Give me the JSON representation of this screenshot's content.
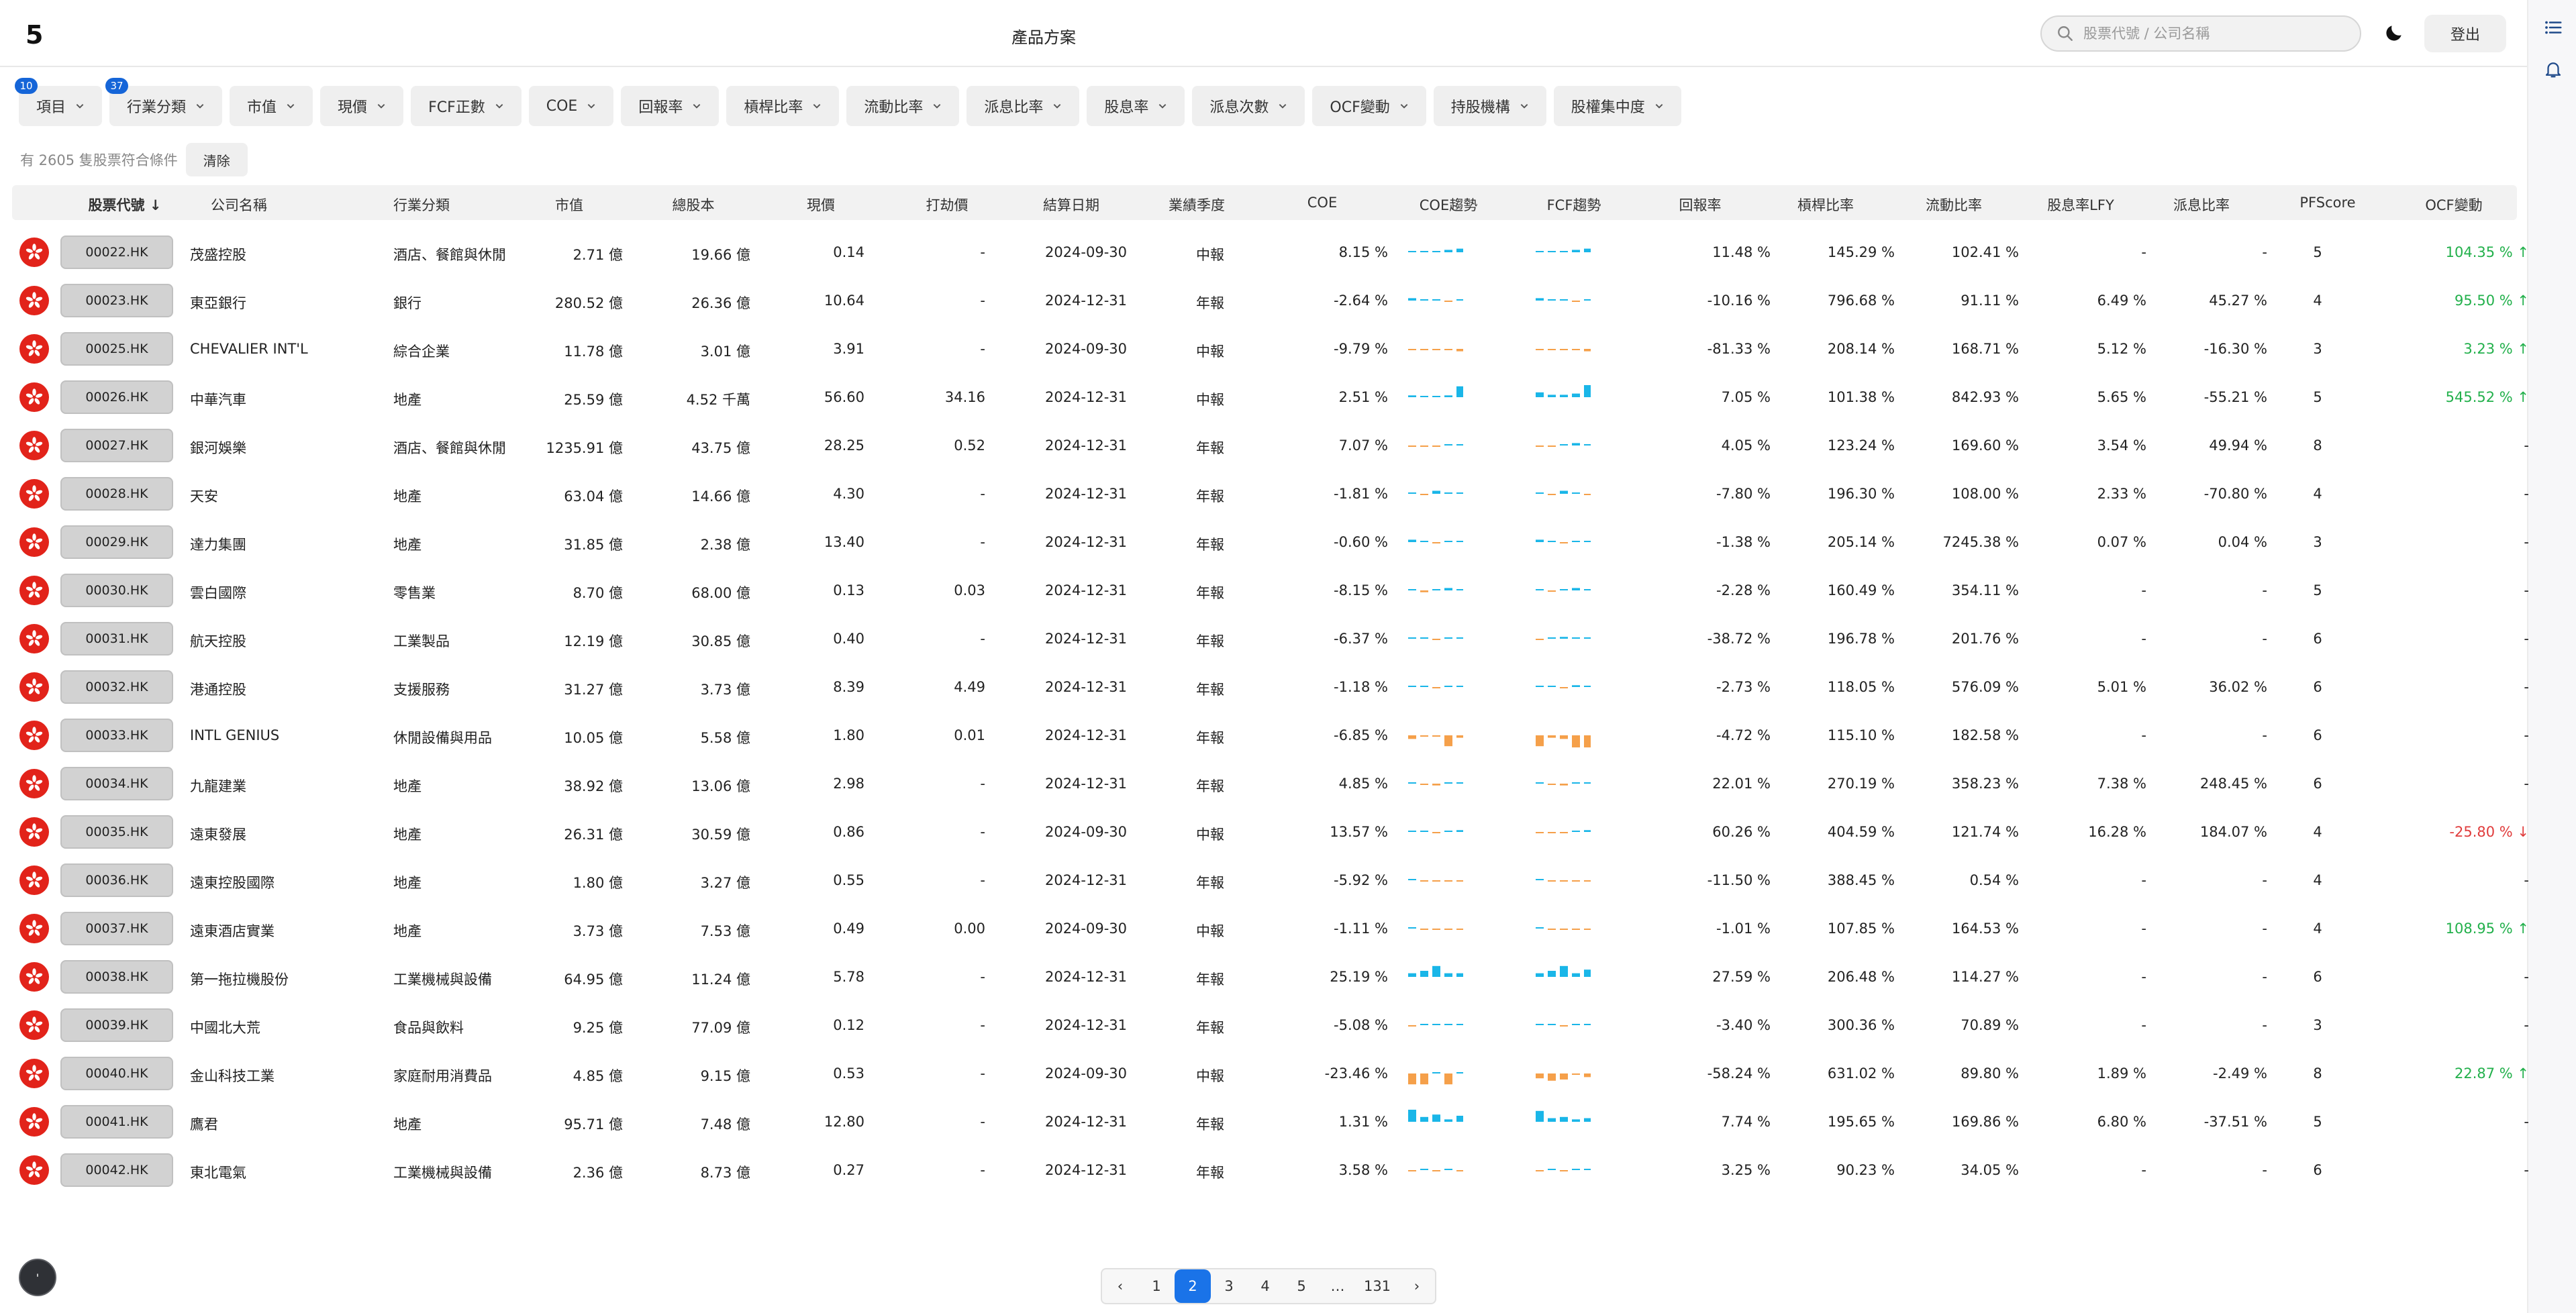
{
  "header": {
    "logo": "5",
    "title": "產品方案",
    "search_placeholder": "股票代號 / 公司名稱",
    "logout": "登出"
  },
  "filters": [
    {
      "label": "項目",
      "badge": "10"
    },
    {
      "label": "行業分類",
      "badge": "37"
    },
    {
      "label": "市值",
      "badge": ""
    },
    {
      "label": "現價",
      "badge": ""
    },
    {
      "label": "FCF正數",
      "badge": ""
    },
    {
      "label": "COE",
      "badge": ""
    },
    {
      "label": "回報率",
      "badge": ""
    },
    {
      "label": "槓桿比率",
      "badge": ""
    },
    {
      "label": "流動比率",
      "badge": ""
    },
    {
      "label": "派息比率",
      "badge": ""
    },
    {
      "label": "股息率",
      "badge": ""
    },
    {
      "label": "派息次數",
      "badge": ""
    },
    {
      "label": "OCF變動",
      "badge": ""
    },
    {
      "label": "持股機構",
      "badge": ""
    },
    {
      "label": "股權集中度",
      "badge": ""
    }
  ],
  "result": {
    "text": "有 2605 隻股票符合條件",
    "clear": "清除"
  },
  "columns": [
    "股票代號 ↓",
    "公司名稱",
    "行業分類",
    "市值",
    "總股本",
    "現價",
    "打劫價",
    "結算日期",
    "業績季度",
    "COE",
    "COE趨勢",
    "FCF趨勢",
    "回報率",
    "槓桿比率",
    "流動比率",
    "股息率LFY",
    "派息比率",
    "PFScore",
    "OCF變動"
  ],
  "rows": [
    {
      "code": "00022.HK",
      "name": "茂盛控股",
      "sector": "酒店、餐館與休閒",
      "mcap": "2.71 億",
      "shares": "19.66 億",
      "price": "0.14",
      "rob": "-",
      "date": "2024-09-30",
      "q": "中報",
      "coe": "8.15 %",
      "ret": "11.48 %",
      "lev": "145.29 %",
      "cur": "102.41 %",
      "div": "-",
      "pay": "-",
      "pf": "5",
      "ocf": "104.35 % ↑",
      "ocf_dir": "up",
      "coe_spark": [
        0.1,
        0.1,
        0.1,
        0.2,
        0.3
      ],
      "fcf_spark": [
        0.1,
        0.1,
        0.1,
        0.2,
        0.3
      ]
    },
    {
      "code": "00023.HK",
      "name": "東亞銀行",
      "sector": "銀行",
      "mcap": "280.52 億",
      "shares": "26.36 億",
      "price": "10.64",
      "rob": "-",
      "date": "2024-12-31",
      "q": "年報",
      "coe": "-2.64 %",
      "ret": "-10.16 %",
      "lev": "796.68 %",
      "cur": "91.11 %",
      "div": "6.49 %",
      "pay": "45.27 %",
      "pf": "4",
      "ocf": "95.50 % ↑",
      "ocf_dir": "up",
      "coe_spark": [
        0.2,
        0.1,
        0,
        -0.1,
        0.1
      ],
      "fcf_spark": [
        0.2,
        0.1,
        0,
        -0.1,
        0.1
      ]
    },
    {
      "code": "00025.HK",
      "name": "CHEVALIER INT'L",
      "sector": "綜合企業",
      "mcap": "11.78 億",
      "shares": "3.01 億",
      "price": "3.91",
      "rob": "-",
      "date": "2024-09-30",
      "q": "中報",
      "coe": "-9.79 %",
      "ret": "-81.33 %",
      "lev": "208.14 %",
      "cur": "168.71 %",
      "div": "5.12 %",
      "pay": "-16.30 %",
      "pf": "3",
      "ocf": "3.23 % ↑",
      "ocf_dir": "up",
      "coe_spark": [
        -0.1,
        -0.1,
        -0.1,
        -0.1,
        -0.2
      ],
      "fcf_spark": [
        -0.1,
        -0.1,
        -0.1,
        -0.1,
        -0.2
      ]
    },
    {
      "code": "00026.HK",
      "name": "中華汽車",
      "sector": "地產",
      "mcap": "25.59 億",
      "shares": "4.52 千萬",
      "price": "56.60",
      "rob": "34.16",
      "date": "2024-12-31",
      "q": "中報",
      "coe": "2.51 %",
      "ret": "7.05 %",
      "lev": "101.38 %",
      "cur": "842.93 %",
      "div": "5.65 %",
      "pay": "-55.21 %",
      "pf": "5",
      "ocf": "545.52 % ↑",
      "ocf_dir": "up",
      "coe_spark": [
        0.15,
        0.1,
        0.1,
        0.15,
        0.9
      ],
      "fcf_spark": [
        0.4,
        0.2,
        0.2,
        0.3,
        1.0
      ]
    },
    {
      "code": "00027.HK",
      "name": "銀河娛樂",
      "sector": "酒店、餐館與休閒",
      "mcap": "1235.91 億",
      "shares": "43.75 億",
      "price": "28.25",
      "rob": "0.52",
      "date": "2024-12-31",
      "q": "年報",
      "coe": "7.07 %",
      "ret": "4.05 %",
      "lev": "123.24 %",
      "cur": "169.60 %",
      "div": "3.54 %",
      "pay": "49.94 %",
      "pf": "8",
      "ocf": "-",
      "ocf_dir": "none",
      "coe_spark": [
        -0.1,
        -0.1,
        -0.1,
        0.1,
        0.1
      ],
      "fcf_spark": [
        -0.1,
        -0.1,
        0.1,
        0.2,
        0.1
      ]
    },
    {
      "code": "00028.HK",
      "name": "天安",
      "sector": "地產",
      "mcap": "63.04 億",
      "shares": "14.66 億",
      "price": "4.30",
      "rob": "-",
      "date": "2024-12-31",
      "q": "年報",
      "coe": "-1.81 %",
      "ret": "-7.80 %",
      "lev": "196.30 %",
      "cur": "108.00 %",
      "div": "2.33 %",
      "pay": "-70.80 %",
      "pf": "4",
      "ocf": "-",
      "ocf_dir": "none",
      "coe_spark": [
        0.1,
        -0.1,
        0.25,
        0.1,
        0.05
      ],
      "fcf_spark": [
        0.05,
        -0.1,
        0.25,
        0.1,
        -0.05
      ]
    },
    {
      "code": "00029.HK",
      "name": "達力集團",
      "sector": "地產",
      "mcap": "31.85 億",
      "shares": "2.38 億",
      "price": "13.40",
      "rob": "-",
      "date": "2024-12-31",
      "q": "年報",
      "coe": "-0.60 %",
      "ret": "-1.38 %",
      "lev": "205.14 %",
      "cur": "7245.38 %",
      "div": "0.07 %",
      "pay": "0.04 %",
      "pf": "3",
      "ocf": "-",
      "ocf_dir": "none",
      "coe_spark": [
        0.2,
        0,
        -0.1,
        0.1,
        0.05
      ],
      "fcf_spark": [
        0.2,
        0,
        -0.1,
        0.1,
        0.05
      ]
    },
    {
      "code": "00030.HK",
      "name": "雲白國際",
      "sector": "零售業",
      "mcap": "8.70 億",
      "shares": "68.00 億",
      "price": "0.13",
      "rob": "0.03",
      "date": "2024-12-31",
      "q": "年報",
      "coe": "-8.15 %",
      "ret": "-2.28 %",
      "lev": "160.49 %",
      "cur": "354.11 %",
      "div": "-",
      "pay": "-",
      "pf": "5",
      "ocf": "-",
      "ocf_dir": "none",
      "coe_spark": [
        0,
        -0.15,
        0,
        0.2,
        0
      ],
      "fcf_spark": [
        0,
        -0.1,
        0,
        0.2,
        0
      ]
    },
    {
      "code": "00031.HK",
      "name": "航天控股",
      "sector": "工業製品",
      "mcap": "12.19 億",
      "shares": "30.85 億",
      "price": "0.40",
      "rob": "-",
      "date": "2024-12-31",
      "q": "年報",
      "coe": "-6.37 %",
      "ret": "-38.72 %",
      "lev": "196.78 %",
      "cur": "201.76 %",
      "div": "-",
      "pay": "-",
      "pf": "6",
      "ocf": "-",
      "ocf_dir": "none",
      "coe_spark": [
        0.1,
        0.1,
        -0.1,
        0.1,
        0.05
      ],
      "fcf_spark": [
        -0.1,
        0.1,
        0.15,
        0.1,
        0.05
      ]
    },
    {
      "code": "00032.HK",
      "name": "港通控股",
      "sector": "支援服務",
      "mcap": "31.27 億",
      "shares": "3.73 億",
      "price": "8.39",
      "rob": "4.49",
      "date": "2024-12-31",
      "q": "年報",
      "coe": "-1.18 %",
      "ret": "-2.73 %",
      "lev": "118.05 %",
      "cur": "576.09 %",
      "div": "5.01 %",
      "pay": "36.02 %",
      "pf": "6",
      "ocf": "-",
      "ocf_dir": "none",
      "coe_spark": [
        0.1,
        0.1,
        -0.05,
        0.1,
        0.1
      ],
      "fcf_spark": [
        0.1,
        0.1,
        -0.05,
        0.15,
        0.1
      ]
    },
    {
      "code": "00033.HK",
      "name": "INTL GENIUS",
      "sector": "休閒設備與用品",
      "mcap": "10.05 億",
      "shares": "5.58 億",
      "price": "1.80",
      "rob": "0.01",
      "date": "2024-12-31",
      "q": "年報",
      "coe": "-6.85 %",
      "ret": "-4.72 %",
      "lev": "115.10 %",
      "cur": "182.58 %",
      "div": "-",
      "pay": "-",
      "pf": "6",
      "ocf": "-",
      "ocf_dir": "none",
      "coe_spark": [
        -0.3,
        -0.1,
        -0.1,
        -0.9,
        -0.2
      ],
      "fcf_spark": [
        -0.9,
        -0.2,
        -0.3,
        -1.0,
        -1.0
      ]
    },
    {
      "code": "00034.HK",
      "name": "九龍建業",
      "sector": "地產",
      "mcap": "38.92 億",
      "shares": "13.06 億",
      "price": "2.98",
      "rob": "-",
      "date": "2024-12-31",
      "q": "年報",
      "coe": "4.85 %",
      "ret": "22.01 %",
      "lev": "270.19 %",
      "cur": "358.23 %",
      "div": "7.38 %",
      "pay": "248.45 %",
      "pf": "6",
      "ocf": "-",
      "ocf_dir": "none",
      "coe_spark": [
        0,
        -0.1,
        -0.15,
        0,
        0.05
      ],
      "fcf_spark": [
        0,
        -0.1,
        -0.15,
        0,
        0.05
      ]
    },
    {
      "code": "00035.HK",
      "name": "遠東發展",
      "sector": "地產",
      "mcap": "26.31 億",
      "shares": "30.59 億",
      "price": "0.86",
      "rob": "-",
      "date": "2024-09-30",
      "q": "中報",
      "coe": "13.57 %",
      "ret": "60.26 %",
      "lev": "404.59 %",
      "cur": "121.74 %",
      "div": "16.28 %",
      "pay": "184.07 %",
      "pf": "4",
      "ocf": "-25.80 % ↓",
      "ocf_dir": "down",
      "coe_spark": [
        0.1,
        0.1,
        -0.1,
        0.1,
        0.15
      ],
      "fcf_spark": [
        -0.1,
        -0.1,
        -0.1,
        0.1,
        0.15
      ]
    },
    {
      "code": "00036.HK",
      "name": "遠東控股國際",
      "sector": "地產",
      "mcap": "1.80 億",
      "shares": "3.27 億",
      "price": "0.55",
      "rob": "-",
      "date": "2024-12-31",
      "q": "年報",
      "coe": "-5.92 %",
      "ret": "-11.50 %",
      "lev": "388.45 %",
      "cur": "0.54 %",
      "div": "-",
      "pay": "-",
      "pf": "4",
      "ocf": "-",
      "ocf_dir": "none",
      "coe_spark": [
        0.1,
        -0.1,
        -0.1,
        -0.1,
        -0.1
      ],
      "fcf_spark": [
        0.1,
        -0.1,
        -0.1,
        -0.1,
        -0.1
      ]
    },
    {
      "code": "00037.HK",
      "name": "遠東酒店實業",
      "sector": "地產",
      "mcap": "3.73 億",
      "shares": "7.53 億",
      "price": "0.49",
      "rob": "0.00",
      "date": "2024-09-30",
      "q": "中報",
      "coe": "-1.11 %",
      "ret": "-1.01 %",
      "lev": "107.85 %",
      "cur": "164.53 %",
      "div": "-",
      "pay": "-",
      "pf": "4",
      "ocf": "108.95 % ↑",
      "ocf_dir": "up",
      "coe_spark": [
        0.1,
        -0.1,
        -0.1,
        -0.1,
        -0.1
      ],
      "fcf_spark": [
        0.1,
        -0.1,
        -0.1,
        -0.1,
        -0.1
      ]
    },
    {
      "code": "00038.HK",
      "name": "第一拖拉機股份",
      "sector": "工業機械與設備",
      "mcap": "64.95 億",
      "shares": "11.24 億",
      "price": "5.78",
      "rob": "-",
      "date": "2024-12-31",
      "q": "年報",
      "coe": "25.19 %",
      "ret": "27.59 %",
      "lev": "206.48 %",
      "cur": "114.27 %",
      "div": "-",
      "pay": "-",
      "pf": "6",
      "ocf": "-",
      "ocf_dir": "none",
      "coe_spark": [
        0.3,
        0.5,
        0.9,
        0.3,
        0.3
      ],
      "fcf_spark": [
        0.3,
        0.5,
        0.9,
        0.3,
        0.6
      ]
    },
    {
      "code": "00039.HK",
      "name": "中國北大荒",
      "sector": "食品與飲料",
      "mcap": "9.25 億",
      "shares": "77.09 億",
      "price": "0.12",
      "rob": "-",
      "date": "2024-12-31",
      "q": "年報",
      "coe": "-5.08 %",
      "ret": "-3.40 %",
      "lev": "300.36 %",
      "cur": "70.89 %",
      "div": "-",
      "pay": "-",
      "pf": "3",
      "ocf": "-",
      "ocf_dir": "none",
      "coe_spark": [
        -0.1,
        0,
        0.1,
        0,
        0.1
      ],
      "fcf_spark": [
        0,
        0.1,
        -0.1,
        0,
        0.1
      ]
    },
    {
      "code": "00040.HK",
      "name": "金山科技工業",
      "sector": "家庭耐用消費品",
      "mcap": "4.85 億",
      "shares": "9.15 億",
      "price": "0.53",
      "rob": "-",
      "date": "2024-09-30",
      "q": "中報",
      "coe": "-23.46 %",
      "ret": "-58.24 %",
      "lev": "631.02 %",
      "cur": "89.80 %",
      "div": "1.89 %",
      "pay": "-2.49 %",
      "pf": "8",
      "ocf": "22.87 % ↑",
      "ocf_dir": "up",
      "coe_spark": [
        -0.9,
        -0.9,
        0.1,
        -0.9,
        0.1
      ],
      "fcf_spark": [
        -0.4,
        -0.6,
        -0.5,
        -0.1,
        -0.3
      ]
    },
    {
      "code": "00041.HK",
      "name": "鷹君",
      "sector": "地產",
      "mcap": "95.71 億",
      "shares": "7.48 億",
      "price": "12.80",
      "rob": "-",
      "date": "2024-12-31",
      "q": "年報",
      "coe": "1.31 %",
      "ret": "7.74 %",
      "lev": "195.65 %",
      "cur": "169.86 %",
      "div": "6.80 %",
      "pay": "-37.51 %",
      "pf": "5",
      "ocf": "-",
      "ocf_dir": "none",
      "coe_spark": [
        1.0,
        0.4,
        0.6,
        0.2,
        0.5
      ],
      "fcf_spark": [
        0.9,
        0.3,
        0.4,
        0.2,
        0.3
      ]
    },
    {
      "code": "00042.HK",
      "name": "東北電氣",
      "sector": "工業機械與設備",
      "mcap": "2.36 億",
      "shares": "8.73 億",
      "price": "0.27",
      "rob": "-",
      "date": "2024-12-31",
      "q": "年報",
      "coe": "3.58 %",
      "ret": "3.25 %",
      "lev": "90.23 %",
      "cur": "34.05 %",
      "div": "-",
      "pay": "-",
      "pf": "6",
      "ocf": "-",
      "ocf_dir": "none",
      "coe_spark": [
        -0.1,
        0.1,
        -0.05,
        0.05,
        -0.05
      ],
      "fcf_spark": [
        -0.05,
        0.05,
        -0.1,
        0.05,
        0.1
      ]
    }
  ],
  "pagination": {
    "prev": "‹",
    "pages": [
      "1",
      "2",
      "3",
      "4",
      "5",
      "…",
      "131"
    ],
    "current": "2",
    "next": "›"
  },
  "colors": {
    "accent": "#1a73e8",
    "spark_pos": "#1ab6e8",
    "spark_neg": "#f5a04a",
    "ocf_up": "#22b04b",
    "ocf_down": "#e03c3c"
  },
  "fab_label": "'"
}
